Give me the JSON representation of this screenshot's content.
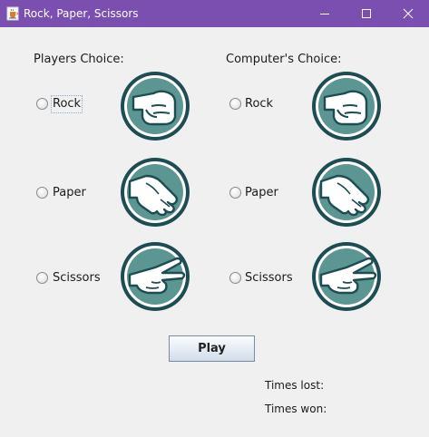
{
  "window": {
    "title": "Rock, Paper, Scissors",
    "icon": "java-cup-icon",
    "controls": {
      "minimize": "minimize-icon",
      "maximize": "maximize-icon",
      "close": "close-icon"
    }
  },
  "player": {
    "heading": "Players Choice:",
    "options": [
      "Rock",
      "Paper",
      "Scissors"
    ]
  },
  "computer": {
    "heading": "Computer's Choice:",
    "options": [
      "Rock",
      "Paper",
      "Scissors"
    ]
  },
  "play_button": "Play",
  "stats": {
    "lost_label": "Times lost:",
    "won_label": "Times won:"
  },
  "colors": {
    "titlebar": "#7b4fb0",
    "icon_ring": "#1d4d52",
    "icon_fill": "#5b9693",
    "hand": "#ffffff"
  }
}
